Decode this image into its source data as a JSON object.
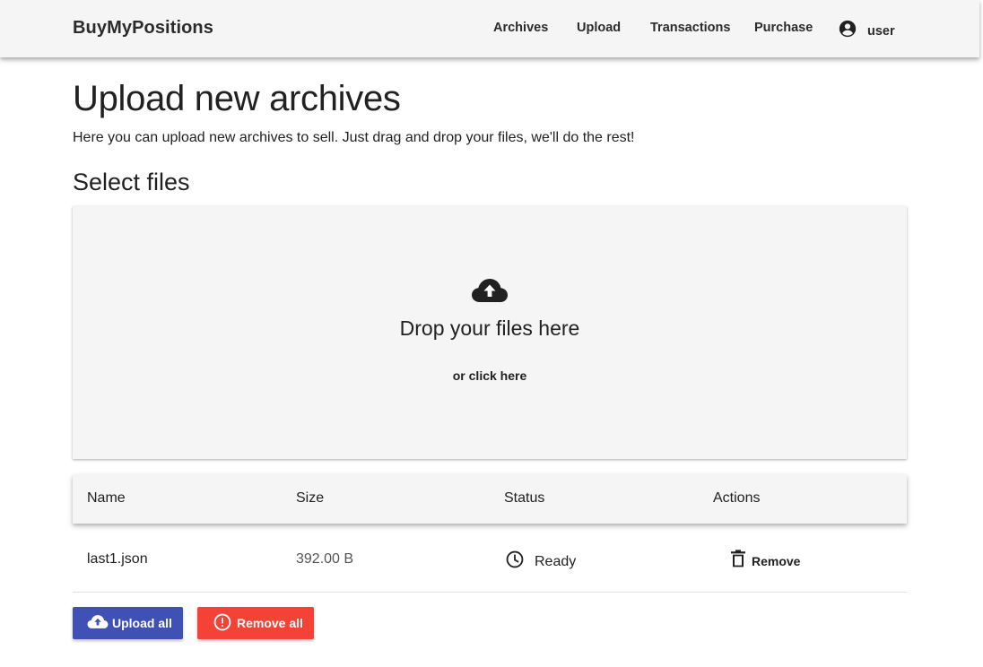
{
  "header": {
    "brand": "BuyMyPositions",
    "nav": [
      "Archives",
      "Upload",
      "Transactions",
      "Purchase"
    ],
    "user_label": "user"
  },
  "page": {
    "title": "Upload new archives",
    "description": "Here you can upload new archives to sell. Just drag and drop your files, we'll do the rest!",
    "section_title": "Select files"
  },
  "dropzone": {
    "text": "Drop your files here",
    "subtext": "or click here",
    "icon": "cloud-upload-icon"
  },
  "table": {
    "columns": [
      "Name",
      "Size",
      "Status",
      "Actions"
    ],
    "rows": [
      {
        "name": "last1.json",
        "size": "392.00 B",
        "status": "Ready",
        "action": "Remove"
      }
    ]
  },
  "buttons": {
    "upload_all": "Upload all",
    "remove_all": "Remove all"
  },
  "colors": {
    "primary": "#3f51b5",
    "danger": "#f44336",
    "surface": "#f5f5f5"
  }
}
